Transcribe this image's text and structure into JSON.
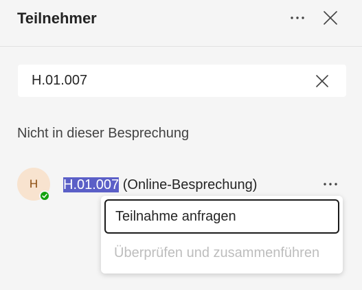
{
  "header": {
    "title": "Teilnehmer",
    "more_icon": "more-horizontal-icon",
    "close_icon": "close-icon"
  },
  "search": {
    "value": "H.01.007",
    "clear_icon": "clear-icon"
  },
  "section": {
    "label": "Nicht in dieser Besprechung"
  },
  "participant": {
    "initials": "H",
    "name_match": "H.01.007",
    "name_suffix": " (Online-Besprechung)",
    "presence": "available",
    "presence_color": "#13a10e",
    "avatar_color": "#f8e3cf",
    "more_icon": "more-horizontal-icon"
  },
  "context_menu": {
    "items": [
      {
        "label": "Teilnahme anfragen",
        "enabled": true
      },
      {
        "label": "Überprüfen und zusammenführen",
        "enabled": false
      }
    ]
  },
  "colors": {
    "highlight": "#5b5fc7",
    "panel_background": "#f5f5f5"
  }
}
